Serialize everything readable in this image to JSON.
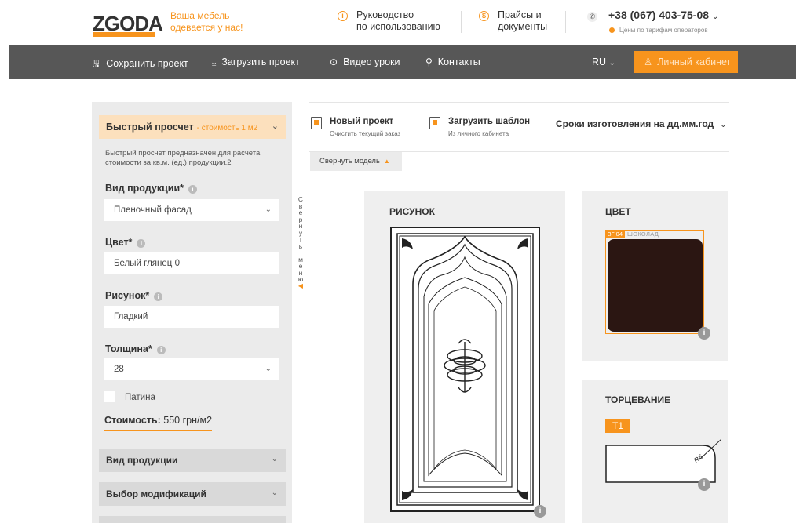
{
  "header": {
    "logo_text": "ZGODA",
    "tagline": "Ваша мебель одевается у нас!",
    "guide": {
      "line1": "Руководство",
      "line2": "по использованию"
    },
    "prices": {
      "line1": "Прайсы и",
      "line2": "документы"
    },
    "phone": "+38 (067) 403-75-08",
    "phone_note": "Цены по тарифам операторов"
  },
  "nav": {
    "save": "Сохранить проект",
    "load": "Загрузить проект",
    "video": "Видео уроки",
    "contacts": "Контакты",
    "lang": "RU",
    "cabinet": "Личный кабинет"
  },
  "panel": {
    "quick_title": "Быстрый просчет",
    "quick_sub": "- стоимость 1 м2",
    "description": "Быстрый просчет предназначен для расчета стоимости за кв.м. (ед.) продукции.2",
    "product_type_label": "Вид продукции*",
    "product_type_value": "Пленочный фасад",
    "color_label": "Цвет*",
    "color_value": "Белый глянец 0",
    "pattern_label": "Рисунок*",
    "pattern_value": "Гладкий",
    "thickness_label": "Толщина*",
    "thickness_value": "28",
    "patina_label": "Патина",
    "cost_label": "Стоимость:",
    "cost_value": "550 грн/м2",
    "accordion": [
      "Вид продукции",
      "Выбор модификаций"
    ],
    "collapse_menu": "Свернуть меню"
  },
  "toolbar": {
    "new_project": "Новый проект",
    "new_project_sub": "Очистить текущий заказ",
    "load_template": "Загрузить шаблон",
    "load_template_sub": "Из личного кабинета",
    "deadline": "Сроки изготовления на дд.мм.год",
    "collapse_model": "Свернуть модель"
  },
  "cards": {
    "drawing_title": "РИСУНОК",
    "color_title": "ЦВЕТ",
    "color_code": "ЗГ 04",
    "color_name": "ШОКОЛАД",
    "edge_title": "ТОРЦЕВАНИЕ",
    "edge_code": "Т1",
    "edge_radius": "R6"
  },
  "colors": {
    "accent": "#f7941d",
    "nav_bg": "#575757",
    "swatch": "#2b1612"
  }
}
